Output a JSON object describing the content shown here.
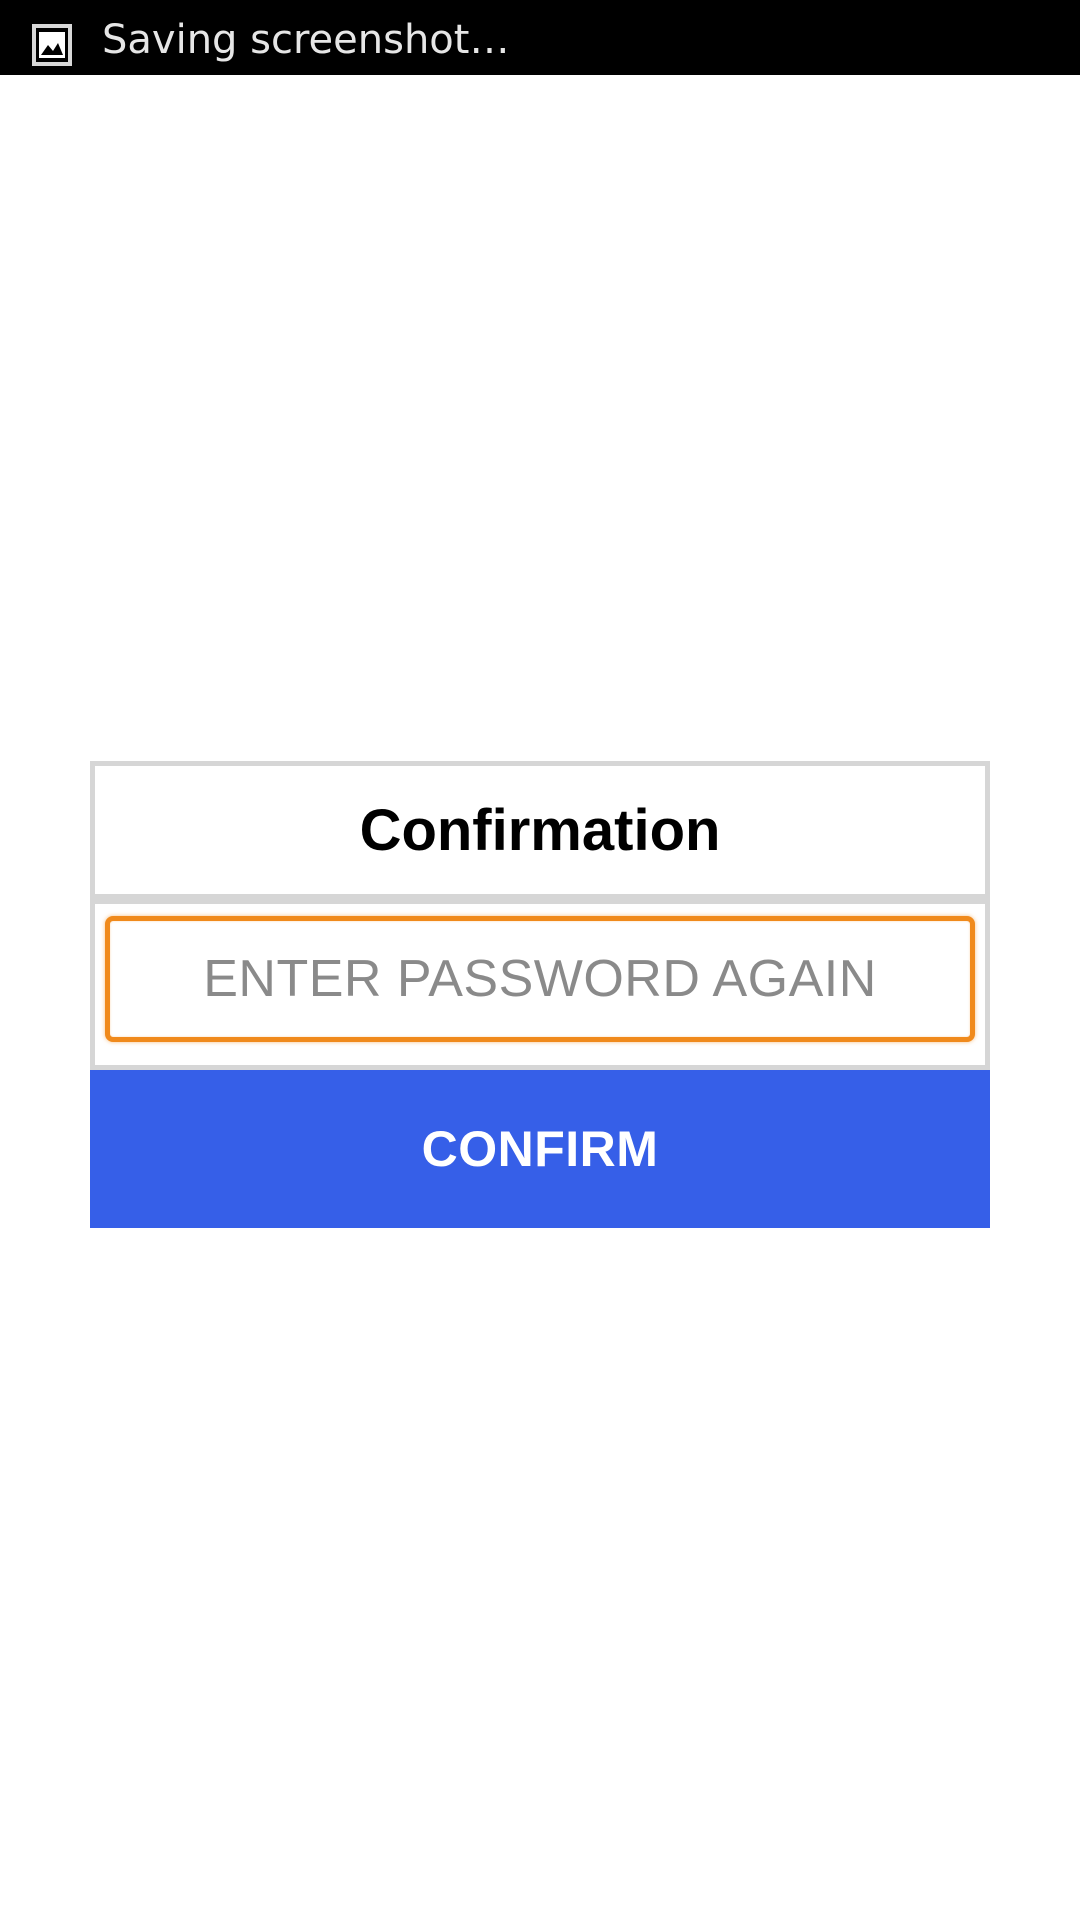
{
  "status_bar": {
    "notification_icon": "image-icon",
    "notification_text": "Saving screenshot…"
  },
  "dialog": {
    "title": "Confirmation",
    "password_field": {
      "value": "",
      "placeholder": "ENTER PASSWORD AGAIN"
    },
    "confirm_label": "CONFIRM"
  },
  "colors": {
    "status_bar_bg": "#000000",
    "dialog_border": "#d6d6d6",
    "input_focus_border": "#f08a1c",
    "confirm_button_bg": "#365fe8",
    "confirm_button_text": "#ffffff",
    "placeholder_text": "#8a8a8a"
  }
}
